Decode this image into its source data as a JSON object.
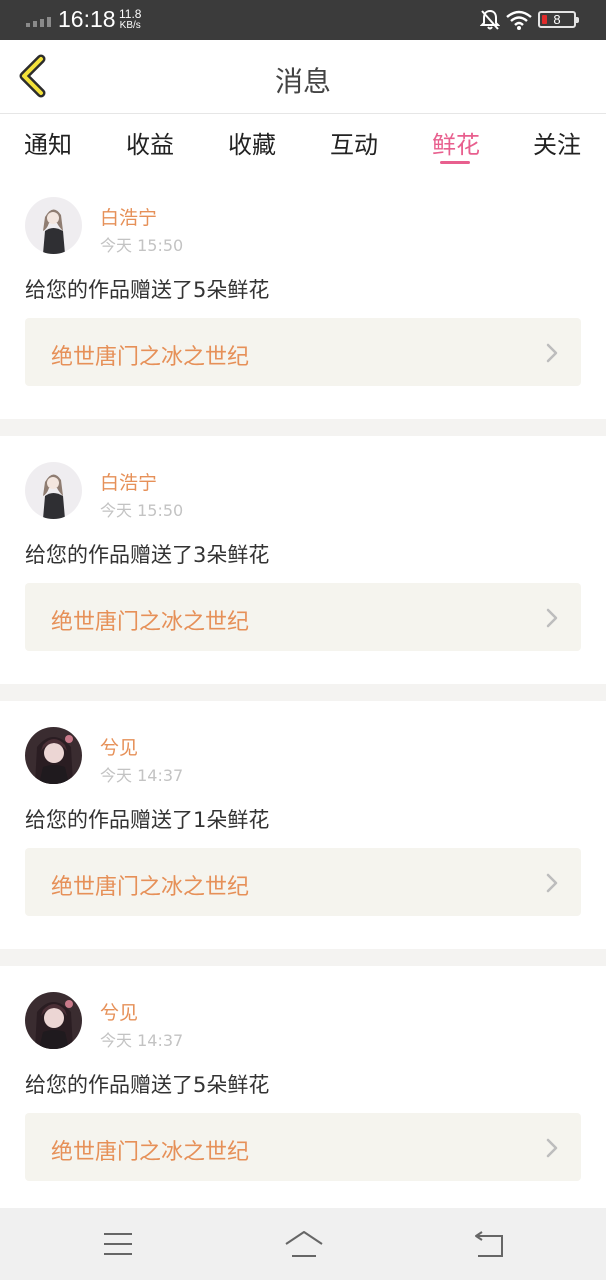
{
  "status_bar": {
    "time": "16:18",
    "net_speed_value": "11.8",
    "net_speed_unit": "KB/s",
    "battery_level": "8",
    "battery_color": "#e02a2a"
  },
  "header": {
    "title": "消息",
    "back_icon": "chevron-left-icon"
  },
  "tabs": [
    {
      "label": "通知"
    },
    {
      "label": "收益"
    },
    {
      "label": "收藏"
    },
    {
      "label": "互动"
    },
    {
      "label": "鲜花"
    },
    {
      "label": "关注"
    }
  ],
  "active_tab": "鲜花",
  "accent_color": "#e85f8e",
  "name_color": "#e69058",
  "messages": [
    {
      "user": "白浩宁",
      "time": "今天 15:50",
      "text": "给您的作品赠送了5朵鲜花",
      "work": "绝世唐门之冰之世纪"
    },
    {
      "user": "白浩宁",
      "time": "今天 15:50",
      "text": "给您的作品赠送了3朵鲜花",
      "work": "绝世唐门之冰之世纪"
    },
    {
      "user": "兮见",
      "time": "今天 14:37",
      "text": "给您的作品赠送了1朵鲜花",
      "work": "绝世唐门之冰之世纪"
    },
    {
      "user": "兮见",
      "time": "今天 14:37",
      "text": "给您的作品赠送了5朵鲜花",
      "work": "绝世唐门之冰之世纪"
    }
  ],
  "partial_item": {
    "user": "兮见"
  },
  "nav_bar": {
    "menu_icon": "menu-icon",
    "home_icon": "home-icon",
    "back_icon": "back-icon"
  }
}
